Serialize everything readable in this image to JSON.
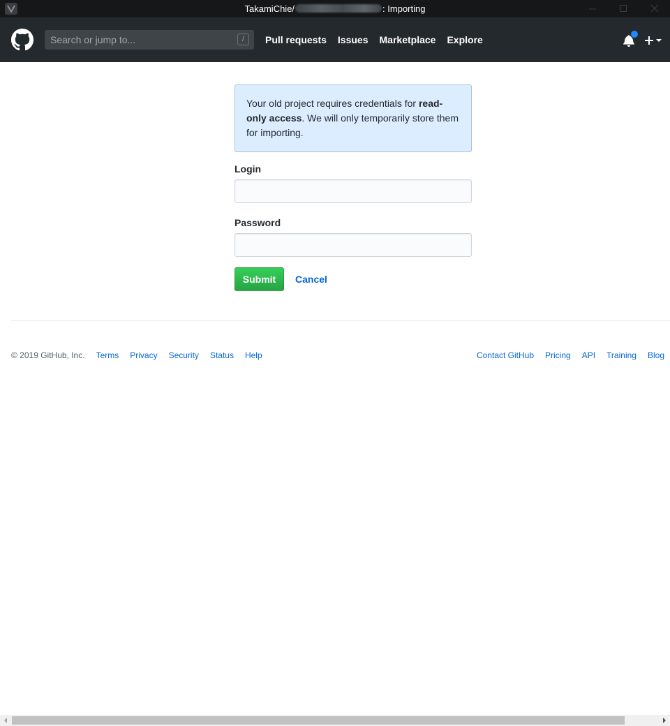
{
  "window": {
    "title_prefix": "TakamiChie/",
    "title_suffix": ": Importing"
  },
  "header": {
    "search_placeholder": "Search or jump to...",
    "search_shortcut": "/",
    "nav": [
      {
        "label": "Pull requests"
      },
      {
        "label": "Issues"
      },
      {
        "label": "Marketplace"
      },
      {
        "label": "Explore"
      }
    ]
  },
  "notice": {
    "text_before": "Your old project requires credentials for ",
    "text_bold": "read-only access",
    "text_after": ". We will only temporarily store them for importing."
  },
  "form": {
    "login_label": "Login",
    "login_value": "",
    "password_label": "Password",
    "password_value": "",
    "submit_label": "Submit",
    "cancel_label": "Cancel"
  },
  "footer": {
    "copyright": "© 2019 GitHub, Inc.",
    "left_links": [
      "Terms",
      "Privacy",
      "Security",
      "Status",
      "Help"
    ],
    "right_links": [
      "Contact GitHub",
      "Pricing",
      "API",
      "Training",
      "Blog"
    ]
  },
  "colors": {
    "header_bg": "#24292e",
    "notice_bg": "#dbedff",
    "submit_green": "#28a745",
    "link_blue": "#0366d6",
    "notification_dot": "#2188ff"
  }
}
